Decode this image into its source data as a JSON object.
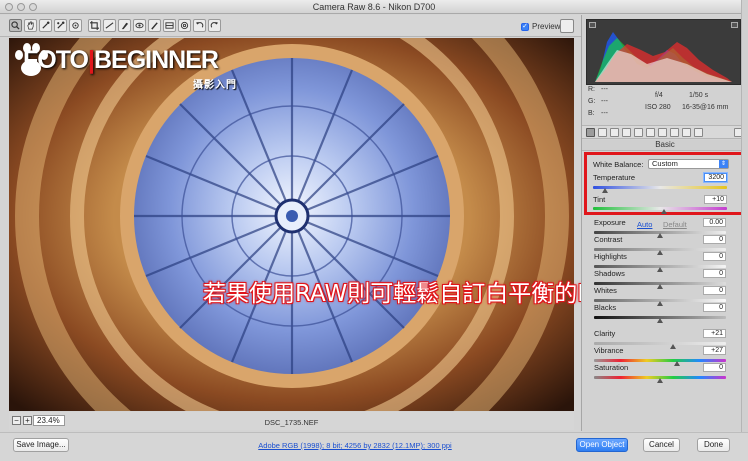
{
  "window": {
    "title": "Camera Raw 8.6  -  Nikon D700"
  },
  "toolbar": {
    "tools": [
      "zoom-tool",
      "hand-tool",
      "white-balance-tool",
      "color-sampler-tool",
      "targeted-adjustment-tool",
      "crop-tool",
      "straighten-tool",
      "spot-removal-tool",
      "red-eye-tool",
      "adjustment-brush-tool",
      "graduated-filter-tool",
      "radial-filter-tool",
      "preferences",
      "rotate-left",
      "rotate-right"
    ],
    "preview_label": "Preview",
    "preview_checked": true
  },
  "image": {
    "logo_text": "FOTO BEGINNER",
    "logo_sub": "攝影入門",
    "overlay_text": "若果使用RAW則可輕鬆自訂白平衡的K數",
    "filename": "DSC_1735.NEF",
    "zoom": "23.4%"
  },
  "readout": {
    "r_label": "R:",
    "g_label": "G:",
    "b_label": "B:",
    "dash": "---",
    "aperture": "f/4",
    "shutter": "1/50 s",
    "iso": "ISO 280",
    "lens": "16-35@16 mm"
  },
  "panel": {
    "section_title": "Basic",
    "white_balance": {
      "label": "White Balance:",
      "value": "Custom"
    },
    "temperature": {
      "label": "Temperature",
      "value": "3200",
      "fraction": 0.09
    },
    "tint": {
      "label": "Tint",
      "value": "+10",
      "fraction": 0.53
    },
    "auto_label": "Auto",
    "default_label": "Default",
    "exposure": {
      "label": "Exposure",
      "value": "0.00",
      "fraction": 0.5
    },
    "contrast": {
      "label": "Contrast",
      "value": "0",
      "fraction": 0.5
    },
    "highlights": {
      "label": "Highlights",
      "value": "0",
      "fraction": 0.5
    },
    "shadows": {
      "label": "Shadows",
      "value": "0",
      "fraction": 0.5
    },
    "whites": {
      "label": "Whites",
      "value": "0",
      "fraction": 0.5
    },
    "blacks": {
      "label": "Blacks",
      "value": "0",
      "fraction": 0.5
    },
    "clarity": {
      "label": "Clarity",
      "value": "+21",
      "fraction": 0.6
    },
    "vibrance": {
      "label": "Vibrance",
      "value": "+27",
      "fraction": 0.63
    },
    "saturation": {
      "label": "Saturation",
      "value": "0",
      "fraction": 0.5
    }
  },
  "bottom": {
    "save_label": "Save Image...",
    "workflow_link": "Adobe RGB (1998); 8 bit; 4256 by 2832 (12.1MP); 300 ppi",
    "open_label": "Open Object",
    "cancel_label": "Cancel",
    "done_label": "Done"
  },
  "colors": {
    "accent_red": "#e0161b",
    "primary_blue": "#2f7ef2"
  }
}
